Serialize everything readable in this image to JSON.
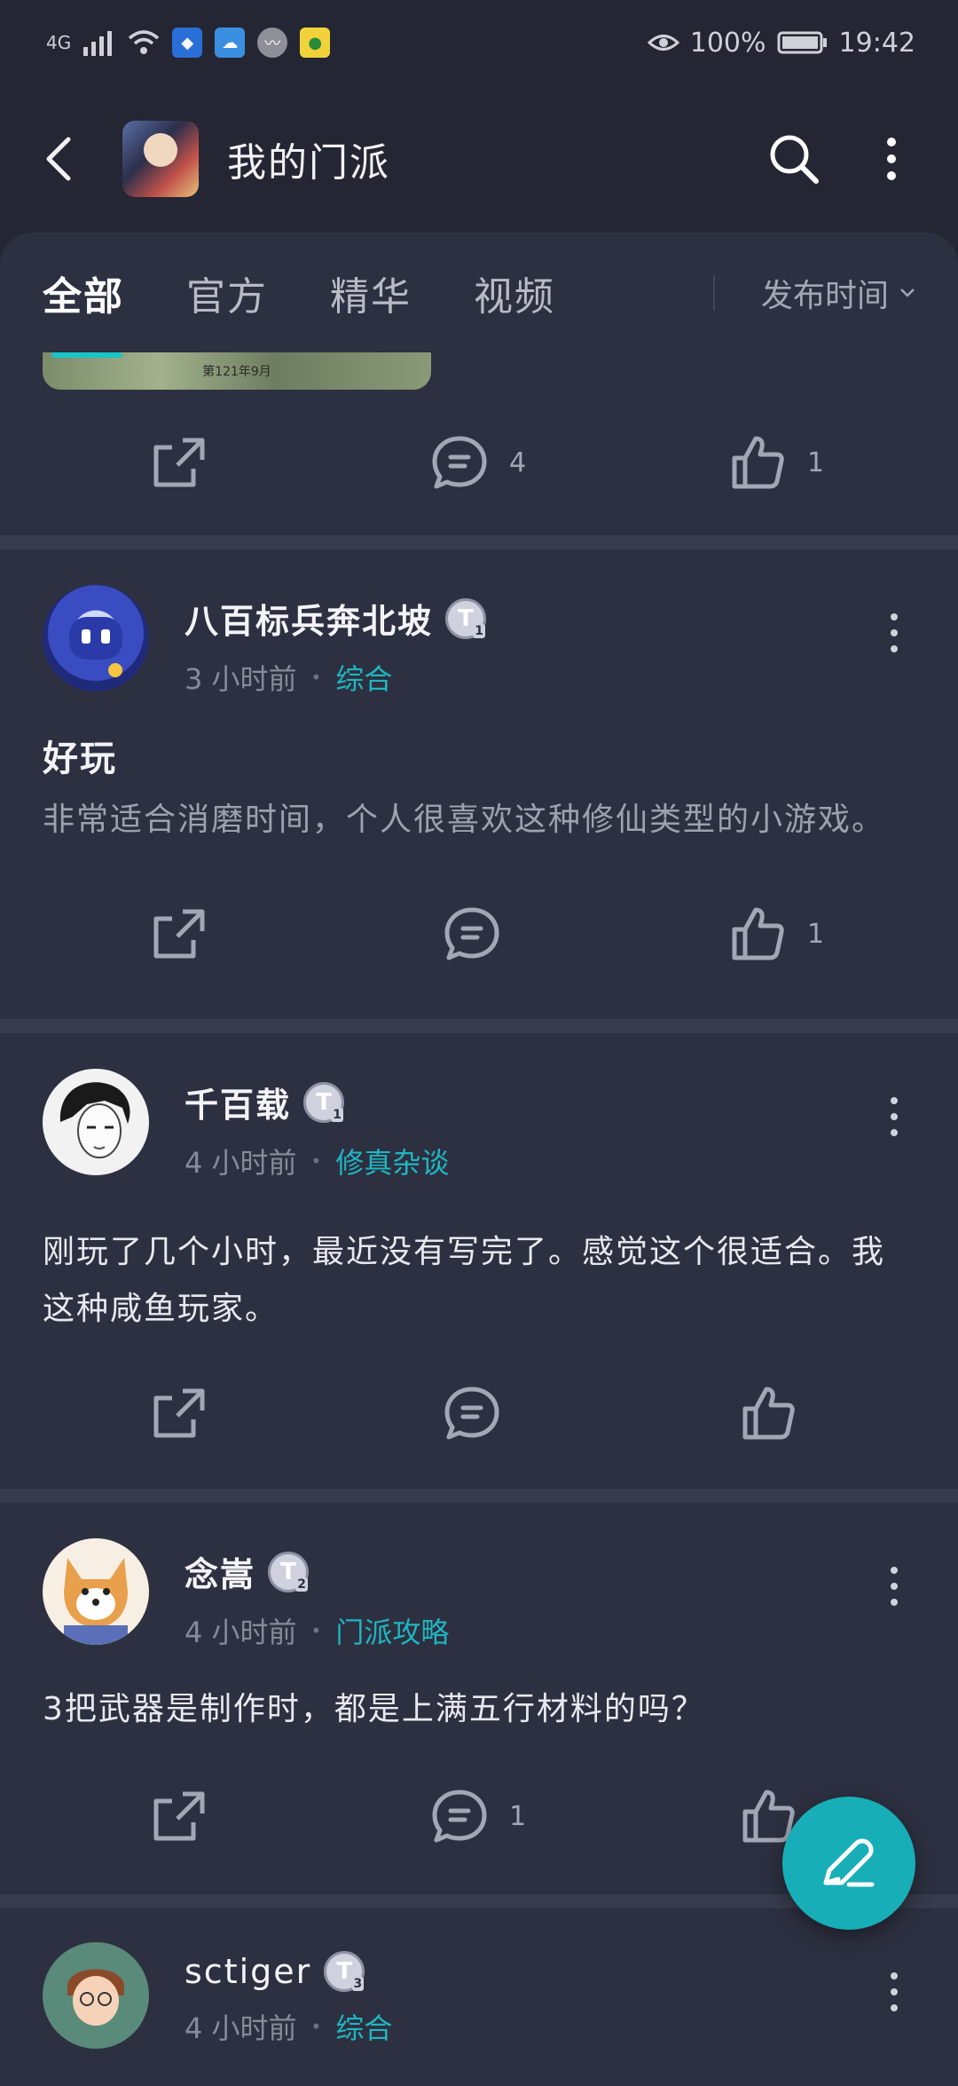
{
  "status_bar": {
    "network": "4G",
    "battery": "100%",
    "time": "19:42"
  },
  "app_bar": {
    "title": "我的门派",
    "icons": [
      "back-icon",
      "game-icon",
      "search-icon",
      "more-vertical-icon"
    ]
  },
  "tabs": {
    "items": [
      "全部",
      "官方",
      "精华",
      "视频"
    ],
    "active": "全部",
    "sort_label": "发布时间"
  },
  "posts": [
    {
      "partial": true,
      "image_caption": "第121年9月",
      "comments": "4",
      "likes": "1"
    },
    {
      "author": "八百标兵奔北坡",
      "badge": "T1",
      "time": "3 小时前",
      "category": "综合",
      "title": "好玩",
      "body": "非常适合消磨时间，个人很喜欢这种修仙类型的小游戏。",
      "comments": "",
      "likes": "1"
    },
    {
      "author": "千百载",
      "badge": "T1",
      "time": "4 小时前",
      "category": "修真杂谈",
      "title": "",
      "body": "刚玩了几个小时，最近没有写完了。感觉这个很适合。我这种咸鱼玩家。",
      "comments": "",
      "likes": ""
    },
    {
      "author": "念嵩",
      "badge": "T2",
      "time": "4 小时前",
      "category": "门派攻略",
      "title": "",
      "body": "3把武器是制作时，都是上满五行材料的吗？",
      "comments": "1",
      "likes": ""
    },
    {
      "author": "sctiger",
      "badge": "T3",
      "time": "4 小时前",
      "category": "综合"
    }
  ],
  "colors": {
    "background": "#242633",
    "card": "#2d3040",
    "accent": "#18aeb8",
    "category": "#1fb6c1"
  }
}
